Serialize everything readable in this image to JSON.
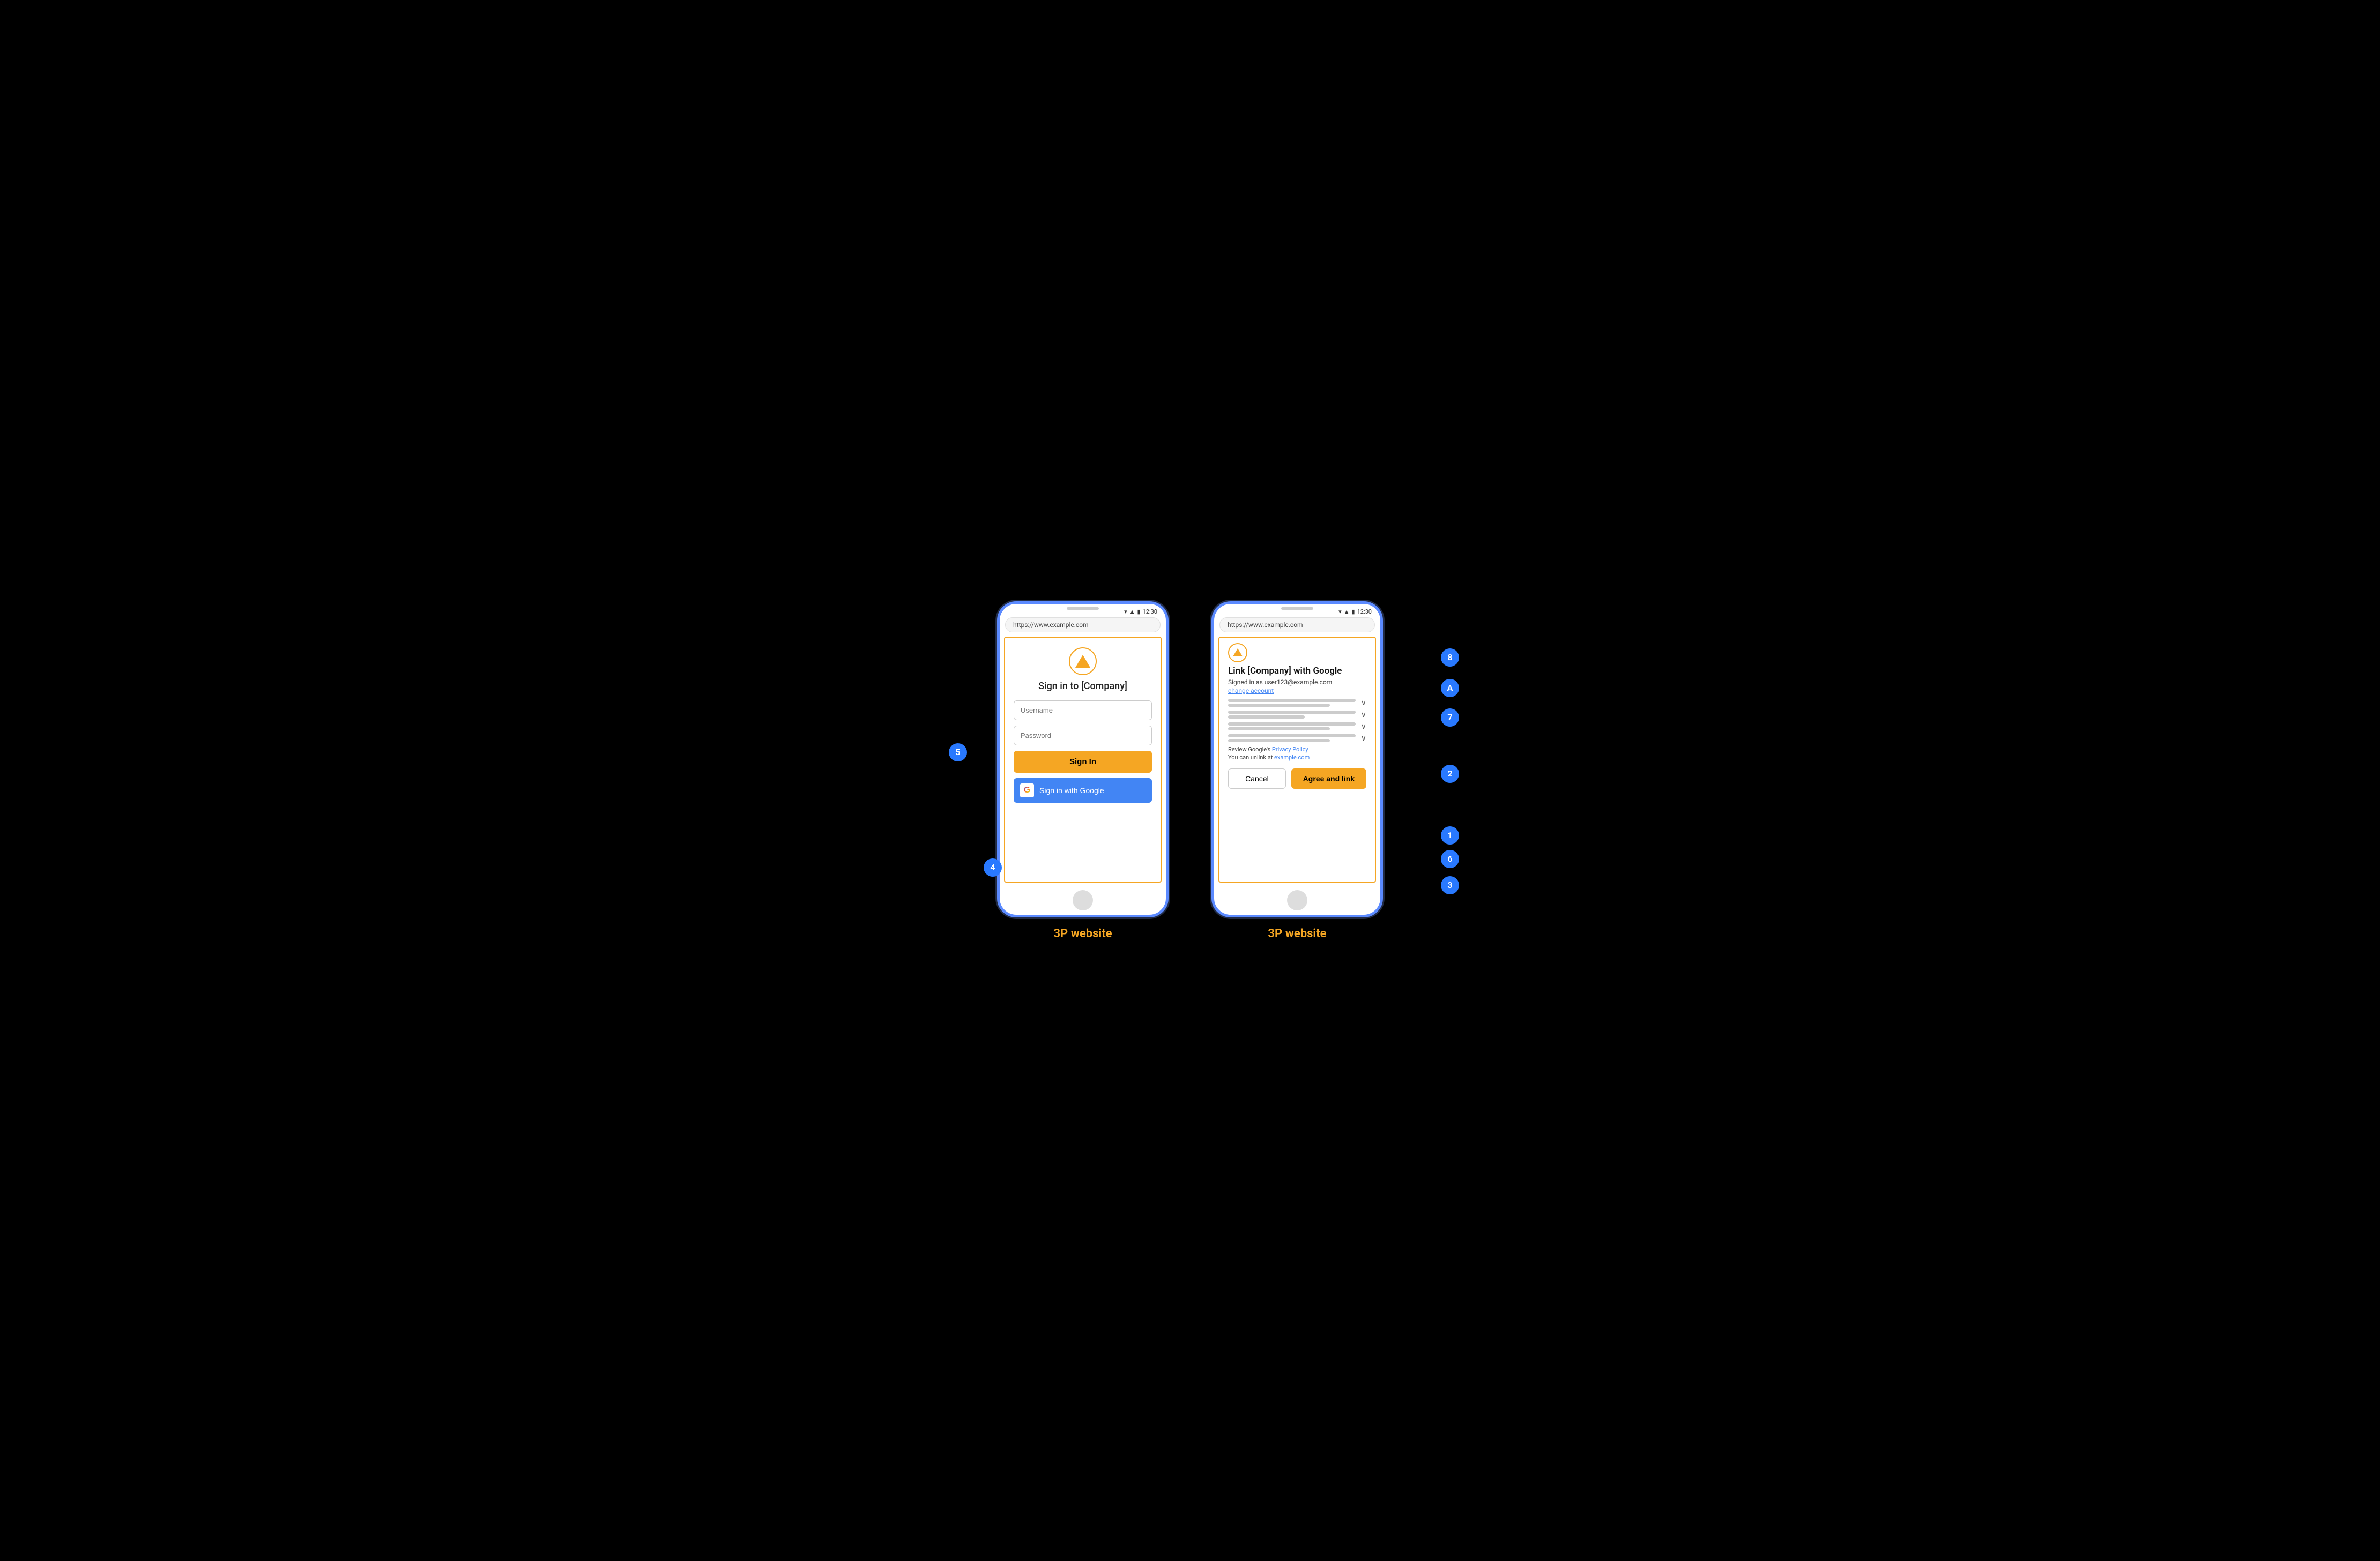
{
  "phone1": {
    "label": "3P website",
    "status_time": "12:30",
    "url": "https://www.example.com",
    "title": "Sign in to [Company]",
    "username_placeholder": "Username",
    "password_placeholder": "Password",
    "sign_in_btn": "Sign In",
    "google_btn": "Sign in with Google"
  },
  "phone2": {
    "label": "3P website",
    "status_time": "12:30",
    "url": "https://www.example.com",
    "title": "Link [Company] with Google",
    "signed_in_as": "Signed in as user123@example.com",
    "change_account": "change account",
    "privacy_text": "Review Google's ",
    "privacy_link": "Privacy Policy",
    "unlink_text": "You can unlink at ",
    "unlink_link": "example.com",
    "cancel_btn": "Cancel",
    "agree_btn": "Agree and link"
  },
  "annotations": {
    "num_1": "1",
    "num_2": "2",
    "num_3": "3",
    "num_4": "4",
    "num_5": "5",
    "num_6": "6",
    "num_7": "7",
    "num_8": "8",
    "letter_a": "A"
  }
}
